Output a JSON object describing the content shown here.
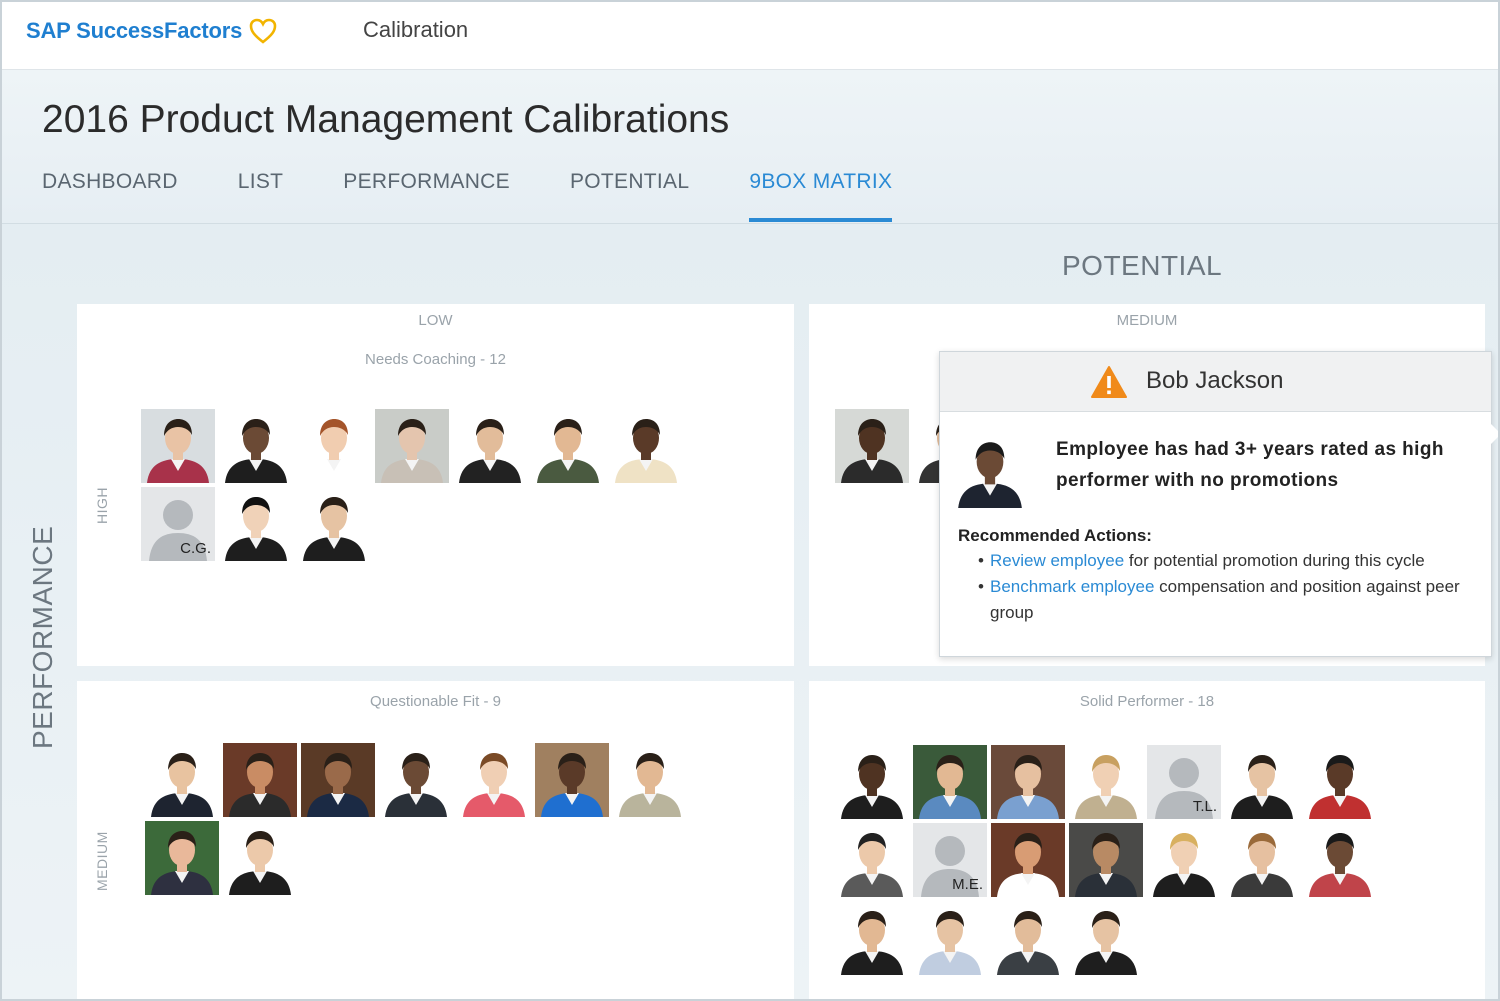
{
  "topbar": {
    "logo_text": "SAP SuccessFactors",
    "app_title": "Calibration"
  },
  "header": {
    "page_title": "2016 Product Management Calibrations",
    "tabs": [
      {
        "label": "DASHBOARD"
      },
      {
        "label": "LIST"
      },
      {
        "label": "PERFORMANCE"
      },
      {
        "label": "POTENTIAL"
      },
      {
        "label": "9BOX MATRIX",
        "active": true
      }
    ]
  },
  "matrix": {
    "axis_potential": "POTENTIAL",
    "axis_performance": "PERFORMANCE",
    "columns": [
      "LOW",
      "MEDIUM"
    ],
    "rows": [
      "HIGH",
      "MEDIUM"
    ],
    "boxes": {
      "high_low": {
        "title": "Needs Coaching - 12"
      },
      "medium_low": {
        "title": "Questionable Fit - 9"
      },
      "medium_medium": {
        "title": "Solid Performer - 18"
      }
    },
    "initials": {
      "cg": "C.G.",
      "tl": "T.L.",
      "me": "M.E."
    }
  },
  "popover": {
    "name": "Bob Jackson",
    "message": "Employee has had 3+ years rated as high performer with no promotions",
    "recommended_label": "Recommended Actions:",
    "actions": [
      {
        "link": "Review employee",
        "text": " for potential promotion during this cycle"
      },
      {
        "link": "Benchmark employee",
        "text": " compensation and position against peer group"
      }
    ]
  },
  "colors": {
    "brand": "#1f7fd0",
    "accent": "#2a8ad4",
    "warning": "#f08a1a"
  }
}
